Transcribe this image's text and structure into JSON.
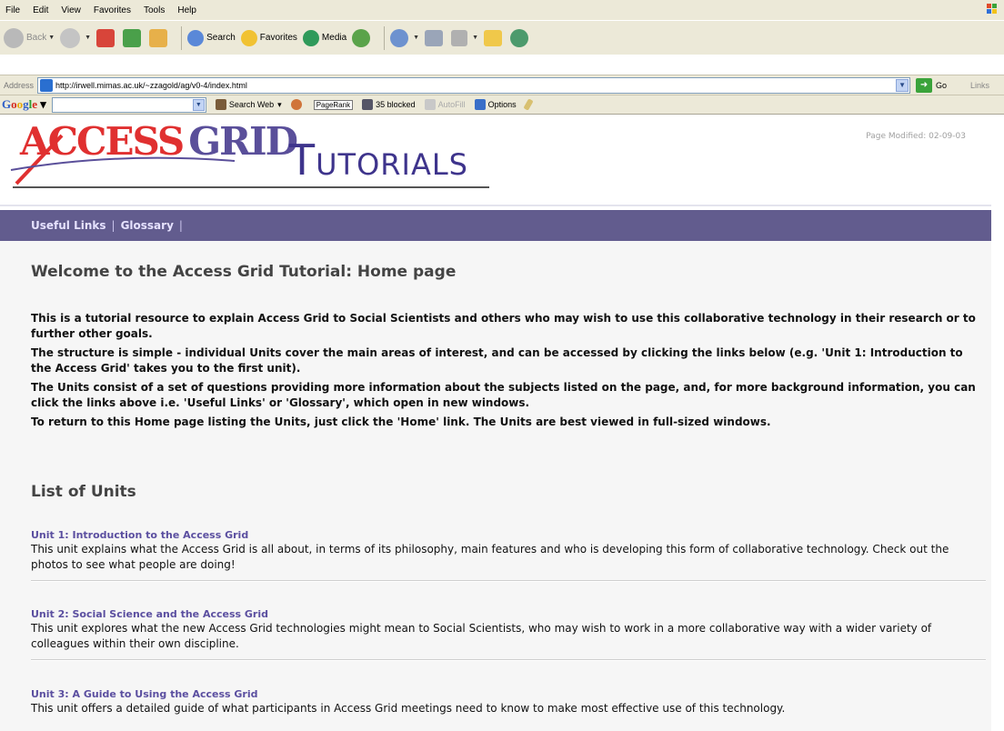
{
  "browser": {
    "menu": [
      "File",
      "Edit",
      "View",
      "Favorites",
      "Tools",
      "Help"
    ],
    "toolbar": {
      "back": "Back",
      "search": "Search",
      "favorites": "Favorites",
      "media": "Media"
    },
    "address": {
      "label": "Address",
      "url": "http://irwell.mimas.ac.uk/~zzagold/ag/v0-4/index.html",
      "go": "Go",
      "links": "Links"
    },
    "googlebar": {
      "logo": "Google",
      "search_web": "Search Web",
      "pagerank": "PageRank",
      "blocked": "35 blocked",
      "autofill": "AutoFill",
      "options": "Options"
    }
  },
  "header": {
    "logo_access": "ACCESS",
    "logo_grid": "GRID",
    "logo_tutorials_first": "T",
    "logo_tutorials_rest": "UTORIALS",
    "page_modified": "Page Modified: 02-09-03"
  },
  "nav": {
    "useful_links": "Useful Links",
    "glossary": "Glossary"
  },
  "content": {
    "welcome_title": "Welcome to the Access Grid Tutorial: Home page",
    "intro": [
      "This is a tutorial resource to explain Access Grid to Social Scientists and others who may wish to use this collaborative technology in their research or to further other goals.",
      "The structure is simple - individual Units cover the main areas of interest, and can be accessed by clicking the links below (e.g. 'Unit 1: Introduction to the Access Grid' takes you to the first unit).",
      "The Units consist of a set of questions providing more information about the subjects listed on the page, and, for more background information, you can click the links above i.e. 'Useful Links' or 'Glossary', which open in new windows.",
      "To return to this Home page listing the Units, just click the 'Home' link. The Units are best viewed in full-sized windows."
    ],
    "list_title": "List of Units",
    "units": [
      {
        "title": "Unit 1: Introduction to the Access Grid",
        "desc": "This unit explains what the Access Grid is all about, in terms of its philosophy, main features and who is developing this form of collaborative technology. Check out the photos to see what people are doing!"
      },
      {
        "title": "Unit 2: Social Science and the Access Grid",
        "desc": "This unit explores what the new Access Grid technologies might mean to Social Scientists, who may wish to work in a more collaborative way with a wider variety of colleagues within their own discipline."
      },
      {
        "title": "Unit 3: A Guide to Using the Access Grid",
        "desc": "This unit offers a detailed guide of what participants in Access Grid meetings need to know to make most effective use of this technology."
      }
    ]
  }
}
